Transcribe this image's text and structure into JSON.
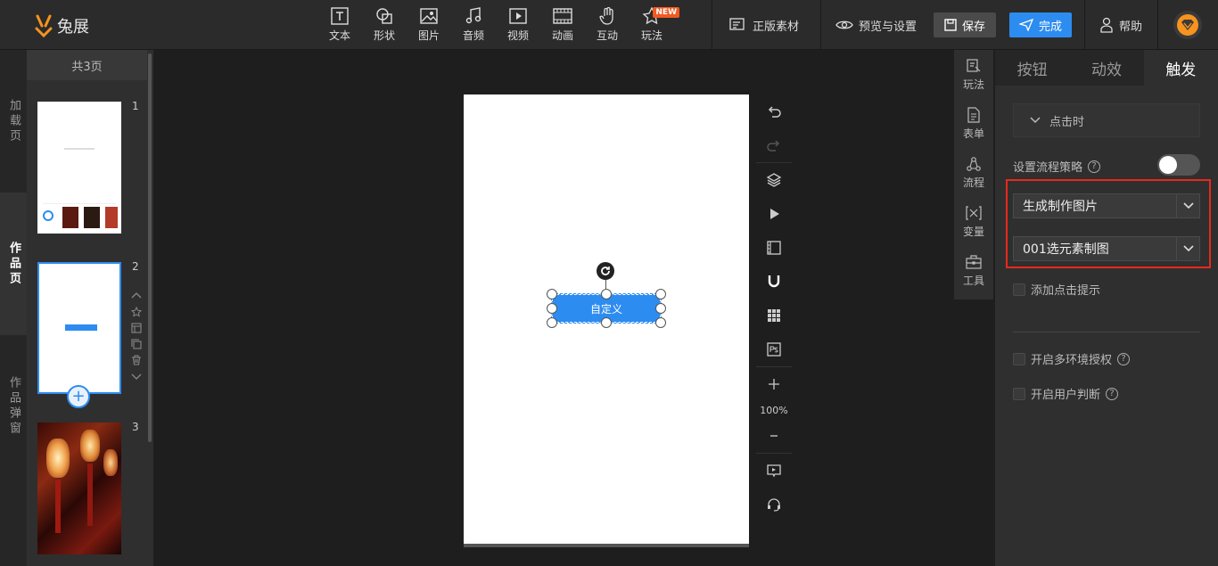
{
  "app": {
    "logo_text": "兔展"
  },
  "toolbar": {
    "tools": [
      {
        "label": "文本",
        "icon": "text-icon"
      },
      {
        "label": "形状",
        "icon": "shape-icon"
      },
      {
        "label": "图片",
        "icon": "image-icon"
      },
      {
        "label": "音频",
        "icon": "music-icon"
      },
      {
        "label": "视频",
        "icon": "video-icon"
      },
      {
        "label": "动画",
        "icon": "animation-icon"
      },
      {
        "label": "互动",
        "icon": "hand-icon"
      },
      {
        "label": "玩法",
        "icon": "star-icon",
        "badge": "NEW"
      }
    ],
    "licensed_assets": "正版素材",
    "preview_settings": "预览与设置",
    "save": "保存",
    "done": "完成",
    "help": "帮助"
  },
  "left_tabs": [
    {
      "label": "加载页",
      "active": false
    },
    {
      "label": "作品页",
      "active": true
    },
    {
      "label": "作品弹窗",
      "active": false
    }
  ],
  "pages": {
    "count_label": "共3页",
    "items": [
      {
        "number": "1"
      },
      {
        "number": "2"
      },
      {
        "number": "3"
      }
    ]
  },
  "canvas": {
    "button_text": "自定义",
    "zoom": "100%"
  },
  "side_tabs": [
    {
      "label": "玩法",
      "icon": "play-edit-icon"
    },
    {
      "label": "表单",
      "icon": "form-icon"
    },
    {
      "label": "流程",
      "icon": "flow-icon"
    },
    {
      "label": "变量",
      "icon": "variable-icon"
    },
    {
      "label": "工具",
      "icon": "toolbox-icon"
    }
  ],
  "right_panel": {
    "tabs": [
      {
        "label": "按钮",
        "active": false
      },
      {
        "label": "动效",
        "active": false
      },
      {
        "label": "触发",
        "active": true
      }
    ],
    "trigger_section": "点击时",
    "process_strategy_label": "设置流程策略",
    "process_strategy_on": false,
    "action_select": "生成制作图片",
    "asset_select": "001选元素制图",
    "add_click_hint": "添加点击提示",
    "multi_env_auth": "开启多环境授权",
    "user_judgement": "开启用户判断",
    "highlight_color": "#e8291c",
    "accent_color": "#2d8cf0"
  }
}
